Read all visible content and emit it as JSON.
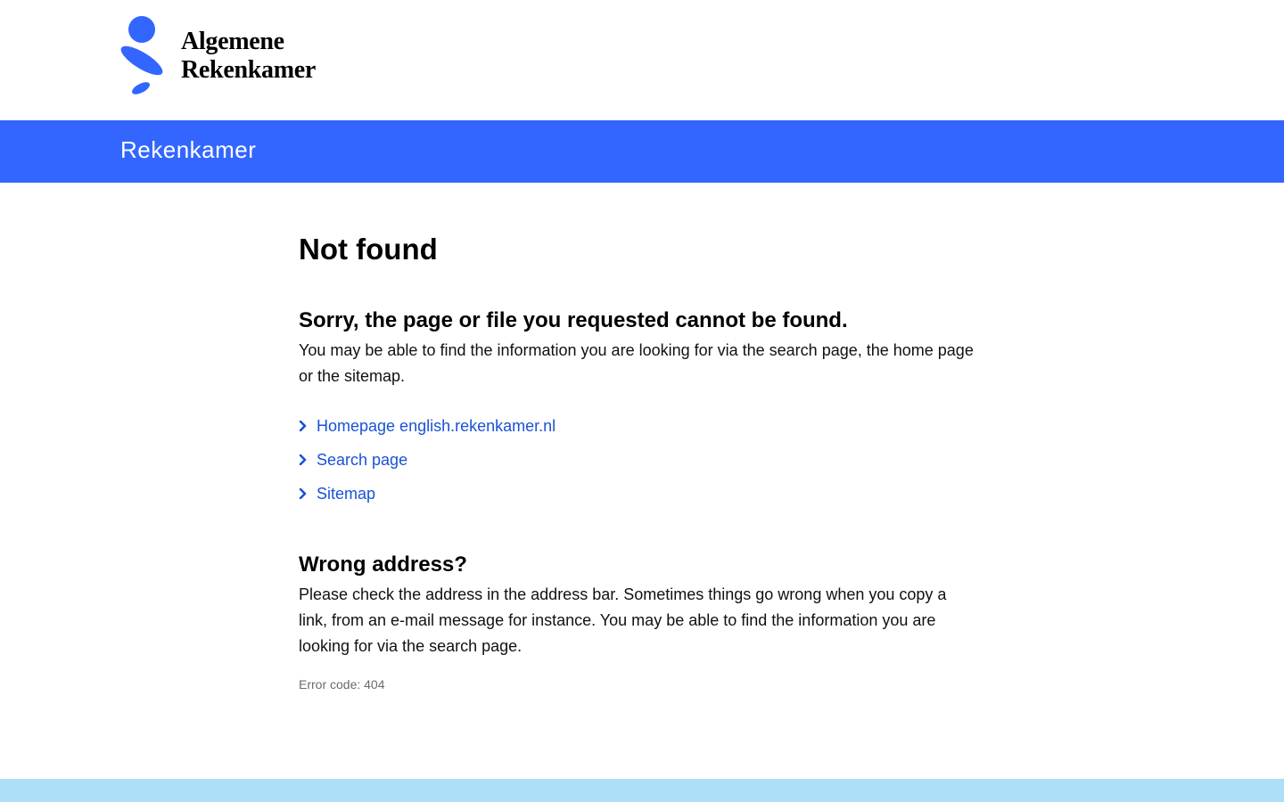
{
  "header": {
    "logo_line1": "Algemene",
    "logo_line2": "Rekenkamer",
    "logo_color": "#3366ff"
  },
  "bluebar": {
    "site_title": "Rekenkamer",
    "color": "#3366ff"
  },
  "main": {
    "title": "Not found",
    "section1": {
      "heading": "Sorry, the page or file you requested cannot be found.",
      "text": "You may be able to find the information you are looking for via the search page, the home page or the sitemap."
    },
    "links": [
      {
        "label": "Homepage english.rekenkamer.nl",
        "icon": "chevron-right-icon"
      },
      {
        "label": "Search page",
        "icon": "chevron-right-icon"
      },
      {
        "label": "Sitemap",
        "icon": "chevron-right-icon"
      }
    ],
    "section2": {
      "heading": "Wrong address?",
      "text": "Please check the address in the address bar. Sometimes things go wrong when you copy a link, from an e-mail message for instance. You may be able to find the information you are looking for via the search page."
    },
    "error_code": "Error code: 404"
  },
  "colors": {
    "link": "#1a52d6",
    "footer": "#addff8"
  }
}
